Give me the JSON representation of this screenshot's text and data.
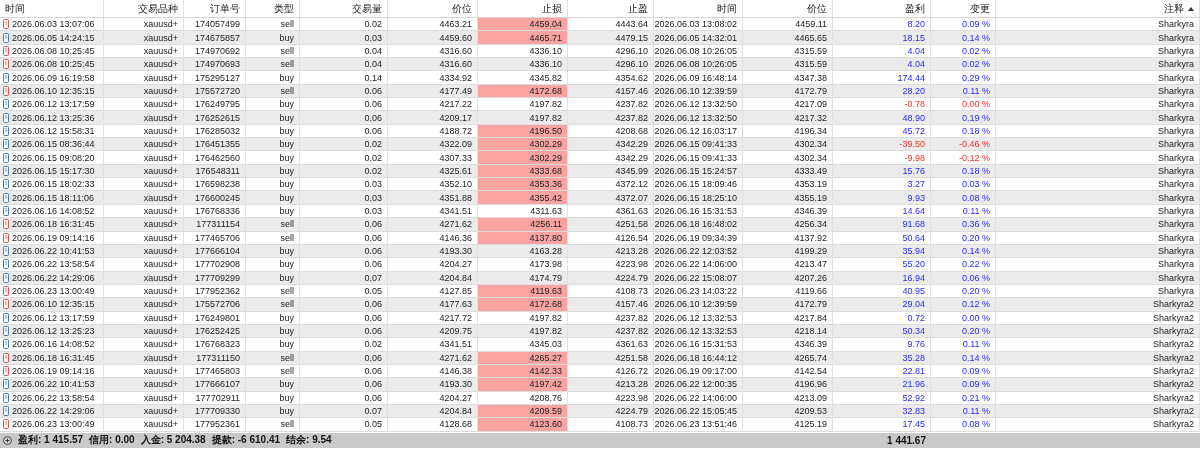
{
  "columns": [
    {
      "label": "时间",
      "sorted": false
    },
    {
      "label": "交易品种",
      "sorted": false
    },
    {
      "label": "订单号",
      "sorted": false
    },
    {
      "label": "类型",
      "sorted": false
    },
    {
      "label": "交易量",
      "sorted": false
    },
    {
      "label": "价位",
      "sorted": false
    },
    {
      "label": "止损",
      "sorted": false
    },
    {
      "label": "止盈",
      "sorted": false
    },
    {
      "label": "时间",
      "sorted": false
    },
    {
      "label": "价位",
      "sorted": false
    },
    {
      "label": "盈利",
      "sorted": false
    },
    {
      "label": "变更",
      "sorted": false
    },
    {
      "label": "注释",
      "sorted": true
    }
  ],
  "rows": [
    {
      "kind": "sell",
      "time": "2026.06.03 13:07:06",
      "symbol": "xauusd+",
      "order": "174057499",
      "type": "sell",
      "volume": "0.02",
      "price": "4463.21",
      "sl": "4459.04",
      "sl_hit": true,
      "tp": "4443.64",
      "close_time": "2026.06.03 13:08:02",
      "close_price": "4459.11",
      "profit": "8.20",
      "change": "0.09 %",
      "loss": false,
      "comment": "Sharkyra"
    },
    {
      "kind": "buy",
      "time": "2026.06.05 14:24:15",
      "symbol": "xauusd+",
      "order": "174675857",
      "type": "buy",
      "volume": "0.03",
      "price": "4459.60",
      "sl": "4465.71",
      "sl_hit": true,
      "tp": "4479.15",
      "close_time": "2026.06.05 14:32:01",
      "close_price": "4465.65",
      "profit": "18.15",
      "change": "0.14 %",
      "loss": false,
      "comment": "Sharkyra"
    },
    {
      "kind": "sell",
      "time": "2026.06.08 10:25:45",
      "symbol": "xauusd+",
      "order": "174970692",
      "type": "sell",
      "volume": "0.04",
      "price": "4316.60",
      "sl": "4336.10",
      "sl_hit": false,
      "tp": "4296.10",
      "close_time": "2026.06.08 10:26:05",
      "close_price": "4315.59",
      "profit": "4.04",
      "change": "0.02 %",
      "loss": false,
      "comment": "Sharkyra"
    },
    {
      "kind": "sell",
      "time": "2026.06.08 10:25:45",
      "symbol": "xauusd+",
      "order": "174970693",
      "type": "sell",
      "volume": "0.04",
      "price": "4316.60",
      "sl": "4336.10",
      "sl_hit": false,
      "tp": "4296.10",
      "close_time": "2026.06.08 10:26:05",
      "close_price": "4315.59",
      "profit": "4.04",
      "change": "0.02 %",
      "loss": false,
      "comment": "Sharkyra"
    },
    {
      "kind": "buy",
      "time": "2026.06.09 16:19:58",
      "symbol": "xauusd+",
      "order": "175295127",
      "type": "buy",
      "volume": "0.14",
      "price": "4334.92",
      "sl": "4345.82",
      "sl_hit": false,
      "tp": "4354.62",
      "close_time": "2026.06.09 16:48:14",
      "close_price": "4347.38",
      "profit": "174.44",
      "change": "0.29 %",
      "loss": false,
      "comment": "Sharkyra"
    },
    {
      "kind": "sell",
      "time": "2026.06.10 12:35:15",
      "symbol": "xauusd+",
      "order": "175572720",
      "type": "sell",
      "volume": "0.06",
      "price": "4177.49",
      "sl": "4172.68",
      "sl_hit": true,
      "tp": "4157.46",
      "close_time": "2026.06.10 12:39:59",
      "close_price": "4172.79",
      "profit": "28.20",
      "change": "0.11 %",
      "loss": false,
      "comment": "Sharkyra"
    },
    {
      "kind": "buy",
      "time": "2026.06.12 13:17:59",
      "symbol": "xauusd+",
      "order": "176249795",
      "type": "buy",
      "volume": "0.06",
      "price": "4217.22",
      "sl": "4197.82",
      "sl_hit": false,
      "tp": "4237.82",
      "close_time": "2026.06.12 13:32:50",
      "close_price": "4217.09",
      "profit": "-0.78",
      "change": "0.00 %",
      "loss": true,
      "comment": "Sharkyra"
    },
    {
      "kind": "buy",
      "time": "2026.06.12 13:25:36",
      "symbol": "xauusd+",
      "order": "176252615",
      "type": "buy",
      "volume": "0.06",
      "price": "4209.17",
      "sl": "4197.82",
      "sl_hit": false,
      "tp": "4237.82",
      "close_time": "2026.06.12 13:32:50",
      "close_price": "4217.32",
      "profit": "48.90",
      "change": "0.19 %",
      "loss": false,
      "comment": "Sharkyra"
    },
    {
      "kind": "buy",
      "time": "2026.06.12 15:58:31",
      "symbol": "xauusd+",
      "order": "176285032",
      "type": "buy",
      "volume": "0.06",
      "price": "4188.72",
      "sl": "4196.50",
      "sl_hit": true,
      "tp": "4208.68",
      "close_time": "2026.06.12 16:03:17",
      "close_price": "4196.34",
      "profit": "45.72",
      "change": "0.18 %",
      "loss": false,
      "comment": "Sharkyra"
    },
    {
      "kind": "buy",
      "time": "2026.06.15 08:36:44",
      "symbol": "xauusd+",
      "order": "176451355",
      "type": "buy",
      "volume": "0.02",
      "price": "4322.09",
      "sl": "4302.29",
      "sl_hit": true,
      "tp": "4342.29",
      "close_time": "2026.06.15 09:41:33",
      "close_price": "4302.34",
      "profit": "-39.50",
      "change": "-0.46 %",
      "loss": true,
      "comment": "Sharkyra"
    },
    {
      "kind": "buy",
      "time": "2026.06.15 09:08:20",
      "symbol": "xauusd+",
      "order": "176462560",
      "type": "buy",
      "volume": "0.02",
      "price": "4307.33",
      "sl": "4302.29",
      "sl_hit": true,
      "tp": "4342.29",
      "close_time": "2026.06.15 09:41:33",
      "close_price": "4302.34",
      "profit": "-9.98",
      "change": "-0.12 %",
      "loss": true,
      "comment": "Sharkyra"
    },
    {
      "kind": "buy",
      "time": "2026.06.15 15:17:30",
      "symbol": "xauusd+",
      "order": "176548311",
      "type": "buy",
      "volume": "0.02",
      "price": "4325.61",
      "sl": "4333.68",
      "sl_hit": true,
      "tp": "4345.99",
      "close_time": "2026.06.15 15:24:57",
      "close_price": "4333.49",
      "profit": "15.76",
      "change": "0.18 %",
      "loss": false,
      "comment": "Sharkyra"
    },
    {
      "kind": "buy",
      "time": "2026.06.15 18:02:33",
      "symbol": "xauusd+",
      "order": "176598238",
      "type": "buy",
      "volume": "0.03",
      "price": "4352.10",
      "sl": "4353.36",
      "sl_hit": true,
      "tp": "4372.12",
      "close_time": "2026.06.15 18:09:46",
      "close_price": "4353.19",
      "profit": "3.27",
      "change": "0.03 %",
      "loss": false,
      "comment": "Sharkyra"
    },
    {
      "kind": "buy",
      "time": "2026.06.15 18:11:06",
      "symbol": "xauusd+",
      "order": "176600245",
      "type": "buy",
      "volume": "0.03",
      "price": "4351.88",
      "sl": "4355.42",
      "sl_hit": true,
      "tp": "4372.07",
      "close_time": "2026.06.15 18:25:10",
      "close_price": "4355.19",
      "profit": "9.93",
      "change": "0.08 %",
      "loss": false,
      "comment": "Sharkyra"
    },
    {
      "kind": "buy",
      "time": "2026.06.16 14:08:52",
      "symbol": "xauusd+",
      "order": "176768336",
      "type": "buy",
      "volume": "0.03",
      "price": "4341.51",
      "sl": "4311.63",
      "sl_hit": false,
      "tp": "4361.63",
      "close_time": "2026.06.16 15:31:53",
      "close_price": "4346.39",
      "profit": "14.64",
      "change": "0.11 %",
      "loss": false,
      "comment": "Sharkyra"
    },
    {
      "kind": "sell",
      "time": "2026.06.18 16:31:45",
      "symbol": "xauusd+",
      "order": "177311154",
      "type": "sell",
      "volume": "0.06",
      "price": "4271.62",
      "sl": "4256.11",
      "sl_hit": true,
      "tp": "4251.58",
      "close_time": "2026.06.18 16:48:02",
      "close_price": "4256.34",
      "profit": "91.68",
      "change": "0.36 %",
      "loss": false,
      "comment": "Sharkyra"
    },
    {
      "kind": "sell",
      "time": "2026.06.19 09:14:16",
      "symbol": "xauusd+",
      "order": "177465706",
      "type": "sell",
      "volume": "0.06",
      "price": "4146.36",
      "sl": "4137.80",
      "sl_hit": true,
      "tp": "4126.54",
      "close_time": "2026.06.19 09:34:39",
      "close_price": "4137.92",
      "profit": "50.64",
      "change": "0.20 %",
      "loss": false,
      "comment": "Sharkyra"
    },
    {
      "kind": "buy",
      "time": "2026.06.22 10:41:53",
      "symbol": "xauusd+",
      "order": "177666104",
      "type": "buy",
      "volume": "0.06",
      "price": "4193.30",
      "sl": "4163.28",
      "sl_hit": false,
      "tp": "4213.28",
      "close_time": "2026.06.22 12:03:52",
      "close_price": "4199.29",
      "profit": "35.94",
      "change": "0.14 %",
      "loss": false,
      "comment": "Sharkyra"
    },
    {
      "kind": "buy",
      "time": "2026.06.22 13:58:54",
      "symbol": "xauusd+",
      "order": "177702908",
      "type": "buy",
      "volume": "0.06",
      "price": "4204.27",
      "sl": "4173.98",
      "sl_hit": false,
      "tp": "4223.98",
      "close_time": "2026.06.22 14:06:00",
      "close_price": "4213.47",
      "profit": "55.20",
      "change": "0.22 %",
      "loss": false,
      "comment": "Sharkyra"
    },
    {
      "kind": "buy",
      "time": "2026.06.22 14:29:06",
      "symbol": "xauusd+",
      "order": "177709299",
      "type": "buy",
      "volume": "0.07",
      "price": "4204.84",
      "sl": "4174.79",
      "sl_hit": false,
      "tp": "4224.79",
      "close_time": "2026.06.22 15:08:07",
      "close_price": "4207.26",
      "profit": "16.94",
      "change": "0.06 %",
      "loss": false,
      "comment": "Sharkyra"
    },
    {
      "kind": "sell",
      "time": "2026.06.23 13:00:49",
      "symbol": "xauusd+",
      "order": "177952362",
      "type": "sell",
      "volume": "0.05",
      "price": "4127.85",
      "sl": "4119.63",
      "sl_hit": true,
      "tp": "4108.73",
      "close_time": "2026.06.23 14:03:22",
      "close_price": "4119.66",
      "profit": "40.95",
      "change": "0.20 %",
      "loss": false,
      "comment": "Sharkyra"
    },
    {
      "kind": "sell",
      "time": "2026.06.10 12:35:15",
      "symbol": "xauusd+",
      "order": "175572706",
      "type": "sell",
      "volume": "0.06",
      "price": "4177.63",
      "sl": "4172.68",
      "sl_hit": true,
      "tp": "4157.46",
      "close_time": "2026.06.10 12:39:59",
      "close_price": "4172.79",
      "profit": "29.04",
      "change": "0.12 %",
      "loss": false,
      "comment": "Sharkyra2"
    },
    {
      "kind": "buy",
      "time": "2026.06.12 13:17:59",
      "symbol": "xauusd+",
      "order": "176249801",
      "type": "buy",
      "volume": "0.06",
      "price": "4217.72",
      "sl": "4197.82",
      "sl_hit": false,
      "tp": "4237.82",
      "close_time": "2026.06.12 13:32:53",
      "close_price": "4217.84",
      "profit": "0.72",
      "change": "0.00 %",
      "loss": false,
      "comment": "Sharkyra2"
    },
    {
      "kind": "buy",
      "time": "2026.06.12 13:25:23",
      "symbol": "xauusd+",
      "order": "176252425",
      "type": "buy",
      "volume": "0.06",
      "price": "4209.75",
      "sl": "4197.82",
      "sl_hit": false,
      "tp": "4237.82",
      "close_time": "2026.06.12 13:32:53",
      "close_price": "4218.14",
      "profit": "50.34",
      "change": "0.20 %",
      "loss": false,
      "comment": "Sharkyra2"
    },
    {
      "kind": "buy",
      "time": "2026.06.16 14:08:52",
      "symbol": "xauusd+",
      "order": "176768323",
      "type": "buy",
      "volume": "0.02",
      "price": "4341.51",
      "sl": "4345.03",
      "sl_hit": false,
      "tp": "4361.63",
      "close_time": "2026.06.16 15:31:53",
      "close_price": "4346.39",
      "profit": "9.76",
      "change": "0.11 %",
      "loss": false,
      "comment": "Sharkyra2"
    },
    {
      "kind": "sell",
      "time": "2026.06.18 16:31:45",
      "symbol": "xauusd+",
      "order": "177311150",
      "type": "sell",
      "volume": "0.06",
      "price": "4271.62",
      "sl": "4265.27",
      "sl_hit": true,
      "tp": "4251.58",
      "close_time": "2026.06.18 16:44:12",
      "close_price": "4265.74",
      "profit": "35.28",
      "change": "0.14 %",
      "loss": false,
      "comment": "Sharkyra2"
    },
    {
      "kind": "sell",
      "time": "2026.06.19 09:14:16",
      "symbol": "xauusd+",
      "order": "177465803",
      "type": "sell",
      "volume": "0.06",
      "price": "4146.38",
      "sl": "4142.33",
      "sl_hit": true,
      "tp": "4126.72",
      "close_time": "2026.06.19 09:17:00",
      "close_price": "4142.54",
      "profit": "22.81",
      "change": "0.09 %",
      "loss": false,
      "comment": "Sharkyra2"
    },
    {
      "kind": "buy",
      "time": "2026.06.22 10:41:53",
      "symbol": "xauusd+",
      "order": "177666107",
      "type": "buy",
      "volume": "0.06",
      "price": "4193.30",
      "sl": "4197.42",
      "sl_hit": true,
      "tp": "4213.28",
      "close_time": "2026.06.22 12:00:35",
      "close_price": "4196.96",
      "profit": "21.96",
      "change": "0.09 %",
      "loss": false,
      "comment": "Sharkyra2"
    },
    {
      "kind": "buy",
      "time": "2026.06.22 13:58:54",
      "symbol": "xauusd+",
      "order": "177702911",
      "type": "buy",
      "volume": "0.06",
      "price": "4204.27",
      "sl": "4208.76",
      "sl_hit": false,
      "tp": "4223.98",
      "close_time": "2026.06.22 14:06:00",
      "close_price": "4213.09",
      "profit": "52.92",
      "change": "0.21 %",
      "loss": false,
      "comment": "Sharkyra2"
    },
    {
      "kind": "buy",
      "time": "2026.06.22 14:29:06",
      "symbol": "xauusd+",
      "order": "177709330",
      "type": "buy",
      "volume": "0.07",
      "price": "4204.84",
      "sl": "4209.59",
      "sl_hit": true,
      "tp": "4224.79",
      "close_time": "2026.06.22 15:05:45",
      "close_price": "4209.53",
      "profit": "32.83",
      "change": "0.11 %",
      "loss": false,
      "comment": "Sharkyra2"
    },
    {
      "kind": "sell",
      "time": "2026.06.23 13:00:49",
      "symbol": "xauusd+",
      "order": "177952361",
      "type": "sell",
      "volume": "0.05",
      "price": "4128.68",
      "sl": "4123.60",
      "sl_hit": true,
      "tp": "4108.73",
      "close_time": "2026.06.23 13:51:46",
      "close_price": "4125.19",
      "profit": "17.45",
      "change": "0.08 %",
      "loss": false,
      "comment": "Sharkyra2"
    }
  ],
  "summary": {
    "items": [
      "盈利: 1 415.57",
      "信用: 0.00",
      "入金: 5 204.38",
      "提款: -6 610.41",
      "结余: 9.54"
    ],
    "total_profit": "1 441.67"
  }
}
